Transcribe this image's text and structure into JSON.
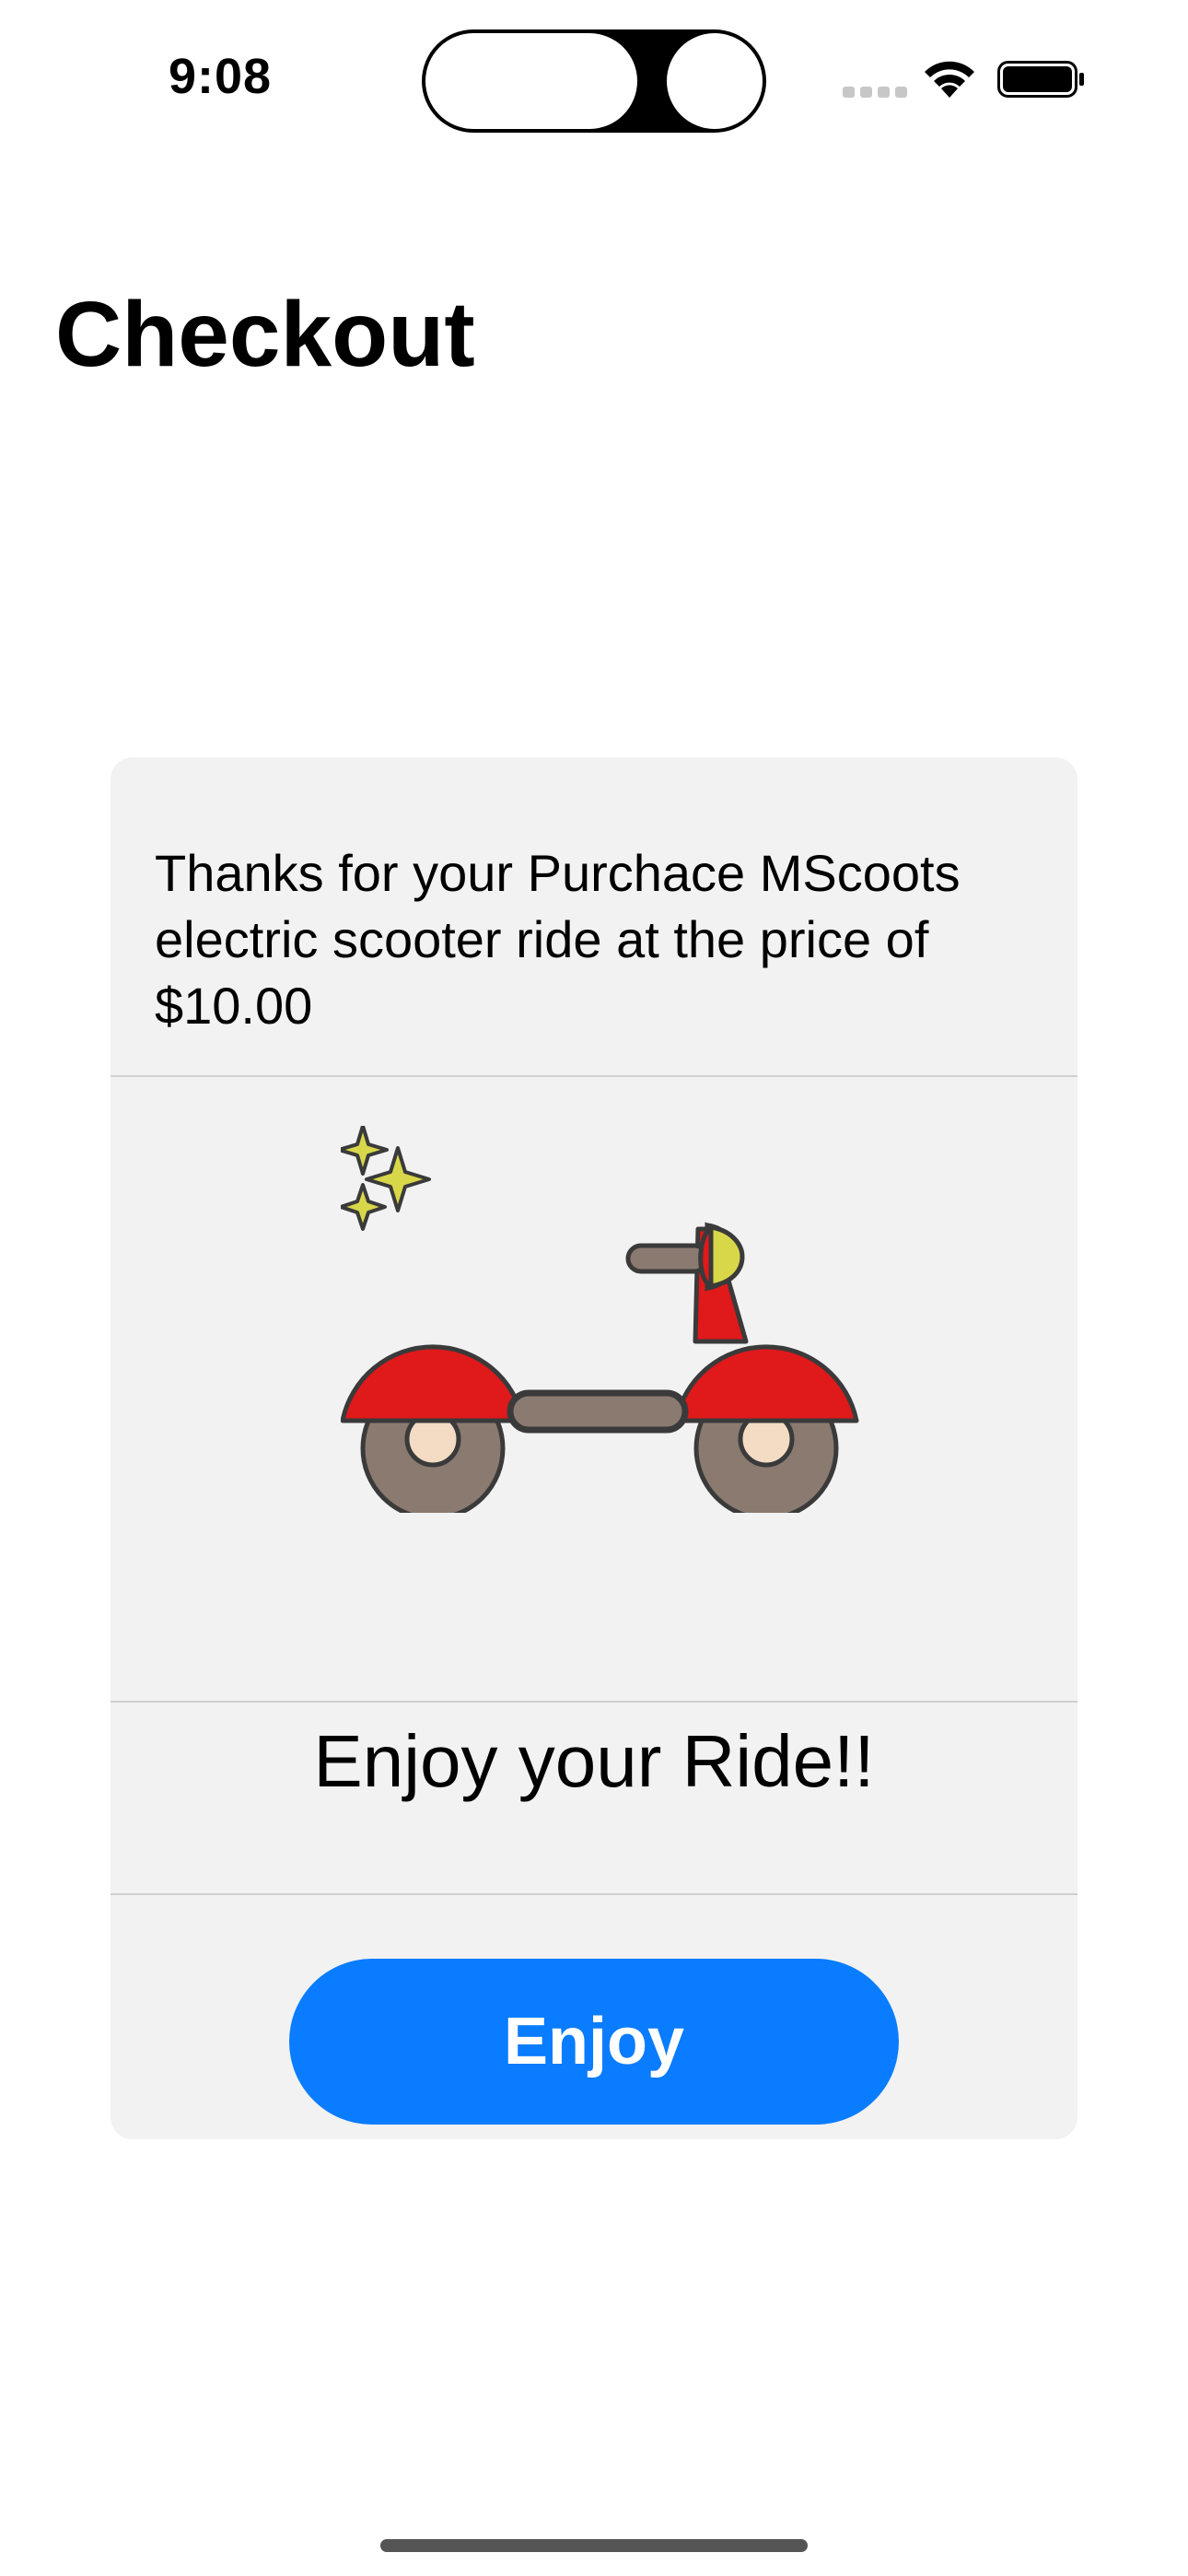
{
  "status_bar": {
    "time": "9:08"
  },
  "page": {
    "title": "Checkout"
  },
  "card": {
    "message": "Thanks for your Purchace MScoots electric scooter ride at the price of $10.00",
    "illustration_icon": "scooter-icon",
    "tagline": "Enjoy your Ride!!",
    "button_label": "Enjoy"
  },
  "colors": {
    "accent": "#0a7cff",
    "card_background": "#f2f2f2",
    "scooter_red": "#e0191b",
    "sparkle_yellow": "#d8d74a",
    "wheel_gray": "#8a7a70"
  }
}
